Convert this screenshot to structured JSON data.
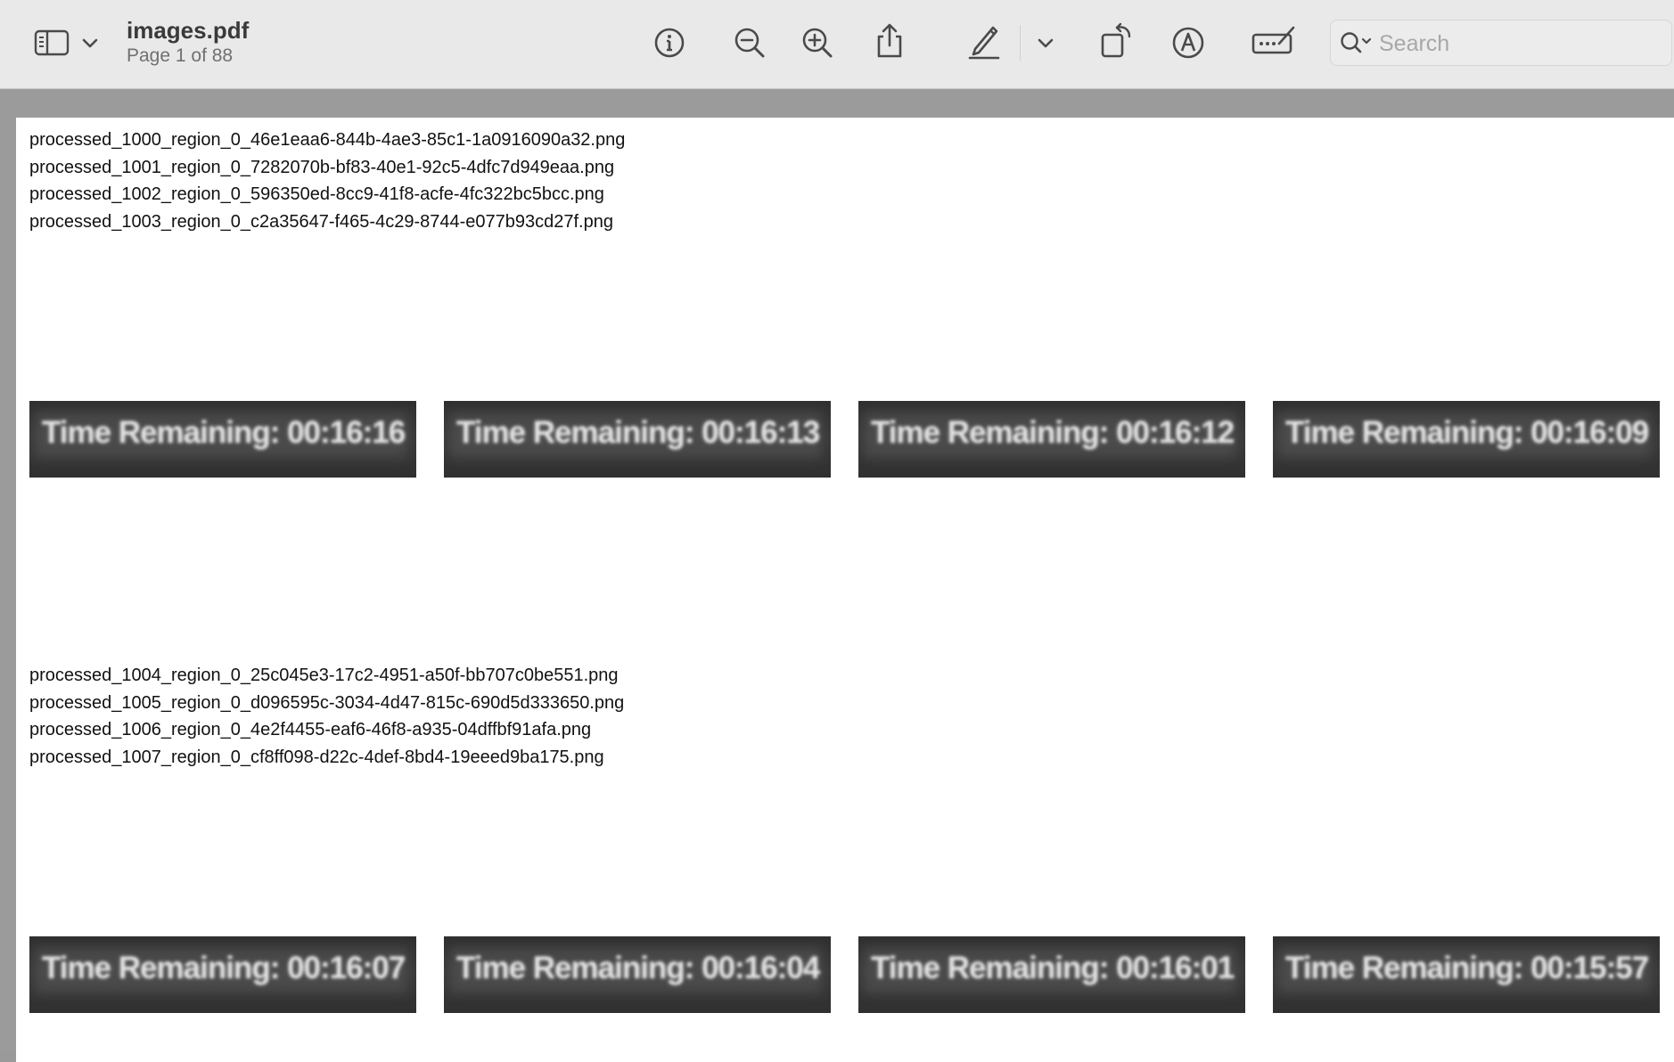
{
  "toolbar": {
    "title": "images.pdf",
    "subtitle": "Page 1 of 88",
    "search_placeholder": "Search",
    "buttons": {
      "sidebar": "sidebar-icon",
      "sidebar_menu": "chevron-down-icon",
      "info": "info-icon",
      "zoom_out": "zoom-out-icon",
      "zoom_in": "zoom-in-icon",
      "share": "share-icon",
      "highlight": "pen-icon",
      "highlight_menu": "chevron-down-icon",
      "rotate": "rotate-icon",
      "markup": "markup-icon",
      "form": "signature-icon"
    }
  },
  "page": {
    "blocks": [
      {
        "files": [
          "processed_1000_region_0_46e1eaa6-844b-4ae3-85c1-1a0916090a32.png",
          "processed_1001_region_0_7282070b-bf83-40e1-92c5-4dfc7d949eaa.png",
          "processed_1002_region_0_596350ed-8cc9-41f8-acfe-4fc322bc5bcc.png",
          "processed_1003_region_0_c2a35647-f465-4c29-8744-e077b93cd27f.png"
        ],
        "thumbnails": [
          "Time Remaining: 00:16:16",
          "Time Remaining: 00:16:13",
          "Time Remaining: 00:16:12",
          "Time Remaining: 00:16:09"
        ]
      },
      {
        "files": [
          "processed_1004_region_0_25c045e3-17c2-4951-a50f-bb707c0be551.png",
          "processed_1005_region_0_d096595c-3034-4d47-815c-690d5d333650.png",
          "processed_1006_region_0_4e2f4455-eaf6-46f8-a935-04dffbf91afa.png",
          "processed_1007_region_0_cf8ff098-d22c-4def-8bd4-19eeed9ba175.png"
        ],
        "thumbnails": [
          "Time Remaining: 00:16:07",
          "Time Remaining: 00:16:04",
          "Time Remaining: 00:16:01",
          "Time Remaining: 00:15:57"
        ]
      }
    ]
  }
}
